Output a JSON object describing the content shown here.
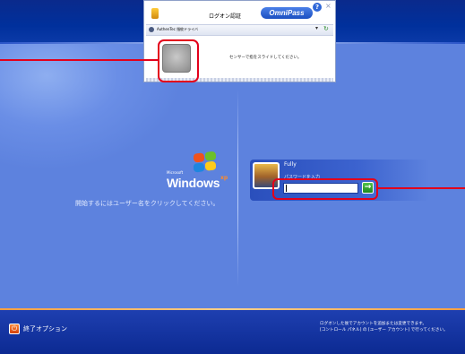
{
  "dialog": {
    "title": "ログオン認証",
    "brand": "OmniPass",
    "help": "?",
    "close": "×",
    "device": "AuthenTec 指紋ドライバ",
    "message": "センサーで指をスライドしてください。"
  },
  "windows_logo": {
    "ms": "Microsoft",
    "name": "Windows",
    "edition": "xp"
  },
  "welcome": {
    "instruction": "開始するにはユーザー名をクリックしてください。"
  },
  "user": {
    "name": "Fully",
    "password_label": "パスワードを入力",
    "password_value": "",
    "go": "→"
  },
  "footer": {
    "shutdown": "終了オプション",
    "note_line1": "ログオンした後でアカウントを追加または変更できます。",
    "note_line2": "[コントロール パネル] の [ユーザー アカウント] で行ってください。"
  },
  "colors": {
    "highlight": "#e3001b",
    "top_bar": "#00309c",
    "panel": "#5d82de"
  }
}
